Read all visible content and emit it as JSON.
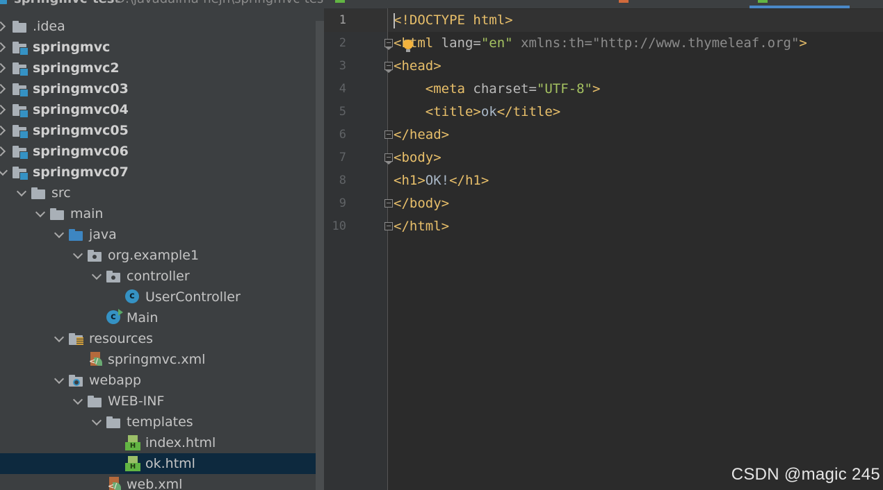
{
  "project": {
    "name": "springmvc-test",
    "path": "D:\\javadaima-hejh\\springmvc-test"
  },
  "tree": [
    {
      "label": "idea_label",
      "text": ".idea",
      "bold": false,
      "arrow": "right",
      "icon": "folder-grey"
    },
    {
      "text": "springmvc",
      "bold": true,
      "arrow": "right",
      "icon": "module-folder"
    },
    {
      "text": "springmvc2",
      "bold": true,
      "arrow": "right",
      "icon": "module-folder"
    },
    {
      "text": "springmvc03",
      "bold": true,
      "arrow": "right",
      "icon": "module-folder"
    },
    {
      "text": "springmvc04",
      "bold": true,
      "arrow": "right",
      "icon": "module-folder"
    },
    {
      "text": "springmvc05",
      "bold": true,
      "arrow": "right",
      "icon": "module-folder"
    },
    {
      "text": "springmvc06",
      "bold": true,
      "arrow": "right",
      "icon": "module-folder"
    },
    {
      "text": "springmvc07",
      "bold": true,
      "arrow": "down",
      "icon": "module-folder"
    },
    {
      "text": "src",
      "bold": false,
      "arrow": "down",
      "icon": "folder-grey"
    },
    {
      "text": "main",
      "bold": false,
      "arrow": "down",
      "icon": "folder-grey"
    },
    {
      "text": "java",
      "bold": false,
      "arrow": "down",
      "icon": "folder-blue"
    },
    {
      "text": "org.example1",
      "bold": false,
      "arrow": "down",
      "icon": "package"
    },
    {
      "text": "controller",
      "bold": false,
      "arrow": "down",
      "icon": "package"
    },
    {
      "text": "UserController",
      "bold": false,
      "arrow": "none",
      "icon": "class"
    },
    {
      "text": "Main",
      "bold": false,
      "arrow": "none",
      "icon": "class-run"
    },
    {
      "text": "resources",
      "bold": false,
      "arrow": "down",
      "icon": "resources-folder"
    },
    {
      "text": "springmvc.xml",
      "bold": false,
      "arrow": "none",
      "icon": "xml-file"
    },
    {
      "text": "webapp",
      "bold": false,
      "arrow": "down",
      "icon": "web-folder"
    },
    {
      "text": "WEB-INF",
      "bold": false,
      "arrow": "down",
      "icon": "folder-grey"
    },
    {
      "text": "templates",
      "bold": false,
      "arrow": "down",
      "icon": "folder-grey"
    },
    {
      "text": "index.html",
      "bold": false,
      "arrow": "none",
      "icon": "html-file"
    },
    {
      "text": "ok.html",
      "bold": false,
      "arrow": "none",
      "icon": "html-file",
      "selected": true
    },
    {
      "text": "web.xml",
      "bold": false,
      "arrow": "none",
      "icon": "xml-file"
    }
  ],
  "editor": {
    "line_numbers": [
      "1",
      "2",
      "3",
      "4",
      "5",
      "6",
      "7",
      "8",
      "9",
      "10"
    ],
    "code": {
      "l1_a": "<!DOCTYPE html>",
      "l2_a": "<html",
      "l2_b": " lang=",
      "l2_c": "\"en\"",
      "l2_d": " xmlns:th=",
      "l2_e": "\"http://www.thymeleaf.org\"",
      "l2_f": ">",
      "l3_a": "<head>",
      "l4_a": "    <meta",
      "l4_b": " charset=",
      "l4_c": "\"UTF-8\"",
      "l4_d": ">",
      "l5_a": "    <title>",
      "l5_b": "ok",
      "l5_c": "</title>",
      "l6_a": "</head>",
      "l7_a": "<body>",
      "l8_a": "<h1>",
      "l8_b": "OK!",
      "l8_c": "</h1>",
      "l9_a": "</body>",
      "l10_a": "</html>"
    }
  },
  "watermark": "CSDN @magic 245"
}
